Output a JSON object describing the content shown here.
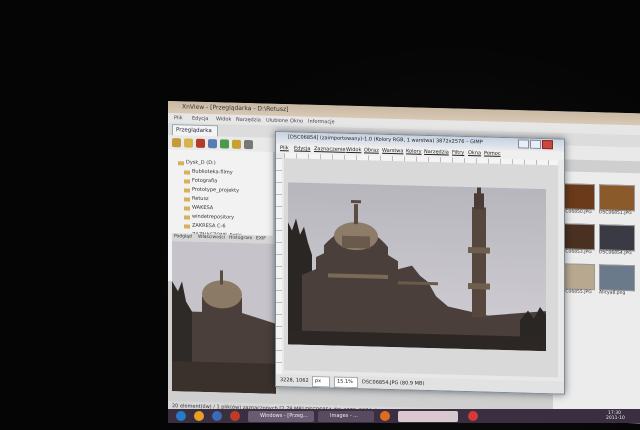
{
  "xnview": {
    "title": "XnView - [Przeglądarka - D:\\Retusz]",
    "menu": [
      "Plik",
      "Edycja",
      "Widok",
      "Narzędzia",
      "Ulubione",
      "Okno",
      "Informacje"
    ],
    "tab": "Przeglądarka",
    "tree": [
      "Dysk_D (D:)",
      "Bublioteka-filmy",
      "Fotografia",
      "Prototype_projekty",
      "Retusz",
      "WAKESA",
      "windetrepository",
      "ZAKRESA C-6",
      "ZAZNACZONE_Fotki"
    ],
    "preview_tabs": [
      "Podgląd",
      "Właściwości",
      "Histogram",
      "EXIF"
    ],
    "thumbnails": [
      "DSC06850.JPG",
      "DSC06851.JPG",
      "DSC06853.JPG",
      "DSC06854.JPG",
      "DSC06855.JPG",
      "Alicya8.png"
    ],
    "status": "20 element(ów) / 1 plik(ów) zaznaczonych [2.78 MB]   DSC06854.JPG   3872x2576x24 (1.78)   24 bits   2.78 MB   15%"
  },
  "gimp": {
    "title": "[DSC06854] (zaimportowany)-1.0 (Kolory RGB, 1 warstwa) 3872x2576 – GIMP",
    "menu": [
      "Plik",
      "Edycja",
      "Zaznaczenie",
      "Widok",
      "Obraz",
      "Warstwa",
      "Kolory",
      "Narzędzia",
      "Filtry",
      "Okna",
      "Pomoc"
    ],
    "coords": "3228, 1062",
    "unit": "px",
    "zoom": "15.1%",
    "status_file": "DSC06854.JPG (80.9 MB)"
  },
  "taskbar": {
    "items": [
      "Windows - [Przeg...",
      "Images - ...",
      ""
    ],
    "clock_time": "17:30",
    "clock_date": "2011-10"
  },
  "colors": {
    "xnview_title": "#c9b9a3",
    "gimp_title": "#c8d2e0",
    "taskbar": "#3a2f40",
    "sky": "#c4c2c8",
    "building": "#4a3f3a"
  }
}
